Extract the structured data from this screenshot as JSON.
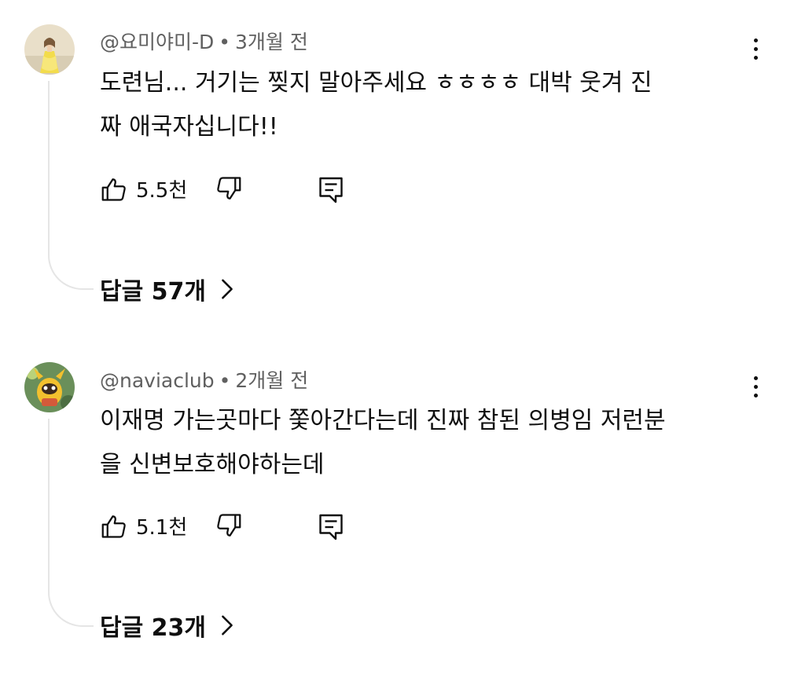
{
  "comments": [
    {
      "author": "@요미야미-D",
      "time": "3개월 전",
      "text_line1": "도련님... 거기는 찢지 말아주세요 ㅎㅎㅎㅎ  대박 웃겨  진",
      "text_line2": "짜 애국자십니다!!",
      "likes": "5.5천",
      "replies_label": "답글 57개",
      "avatar_icon": "princess-avatar",
      "avatar_colors": {
        "bg": "#e9dfc9",
        "dress": "#f3dc4c",
        "hair": "#7a5a3a"
      }
    },
    {
      "author": "@naviaclub",
      "time": "2개월 전",
      "text_line1": "이재명 가는곳마다 쫓아간다는데 진짜 참된 의병임 저런분",
      "text_line2": "을 신변보호해야하는데",
      "likes": "5.1천",
      "replies_label": "답글 23개",
      "avatar_icon": "cartoon-character-avatar",
      "avatar_colors": {
        "bg": "#6a8f5a",
        "body": "#f2c02e",
        "face": "#3b2a1e"
      }
    }
  ],
  "separator": "•",
  "icons": {
    "like": "thumbs-up-icon",
    "dislike": "thumbs-down-icon",
    "reply": "reply-comment-icon",
    "more": "more-vertical-icon",
    "chevron": "chevron-right-icon"
  }
}
